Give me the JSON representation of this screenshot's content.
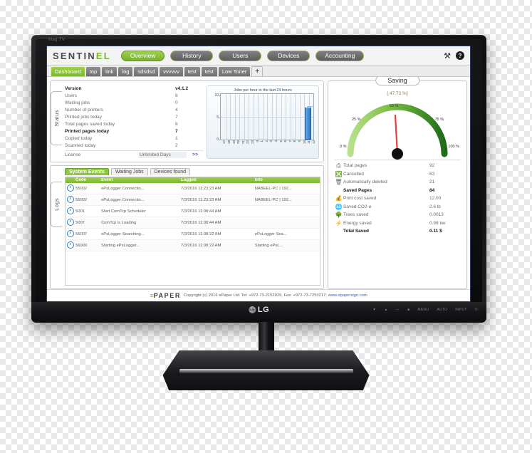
{
  "monitor": {
    "brand_top": "Mag TV",
    "lg_label": "LG",
    "lg_mark": "LG",
    "osd_buttons": [
      "▼",
      "▲",
      "—",
      "■",
      "MENU",
      "AUTO",
      "INPUT",
      "⏻"
    ]
  },
  "navbar": {
    "logo_prefix": "SENTIN",
    "logo_suffix": "EL",
    "buttons": [
      {
        "label": "Overview",
        "active": true
      },
      {
        "label": "History",
        "active": false
      },
      {
        "label": "Users",
        "active": false
      },
      {
        "label": "Devices",
        "active": false
      },
      {
        "label": "Accounting",
        "active": false
      }
    ],
    "tools_icon": "⚒",
    "help_icon": "?"
  },
  "tabs": [
    {
      "label": "Dashboard",
      "selected": true
    },
    {
      "label": "top",
      "selected": false
    },
    {
      "label": "link",
      "selected": false
    },
    {
      "label": "log",
      "selected": false
    },
    {
      "label": "sdsdsd",
      "selected": false
    },
    {
      "label": "vvvvvv",
      "selected": false
    },
    {
      "label": "test",
      "selected": false
    },
    {
      "label": "test",
      "selected": false
    },
    {
      "label": "Low Toner",
      "selected": false
    }
  ],
  "add_tab_label": "+",
  "side_tabs": {
    "status": "Status",
    "logs": "Logs"
  },
  "status": {
    "rows": [
      {
        "key": "Version",
        "value": "v4.1.2",
        "bold": true
      },
      {
        "key": "Users",
        "value": "6",
        "bold": false
      },
      {
        "key": "Waiting jobs",
        "value": "0",
        "bold": false
      },
      {
        "key": "Number of printers",
        "value": "4",
        "bold": false
      },
      {
        "key": "Printed jobs today",
        "value": "7",
        "bold": false
      },
      {
        "key": "Total pages saved today",
        "value": "6",
        "bold": false
      },
      {
        "key": "Printed pages today",
        "value": "7",
        "bold": true
      },
      {
        "key": "Copied today",
        "value": "1",
        "bold": false
      },
      {
        "key": "Scanned today",
        "value": "2",
        "bold": false
      }
    ],
    "license_key": "License",
    "license_value": "Unlimited Days",
    "more_link": ">>"
  },
  "chart_data": {
    "type": "bar",
    "title": "Jobs per hour in the last 24 hours",
    "xlabel": "",
    "ylabel": "",
    "ylim": [
      0,
      10
    ],
    "yticks": [
      0,
      5,
      10
    ],
    "grid": true,
    "legend": "none",
    "categories": [
      "17",
      "18",
      "19",
      "20",
      "21",
      "22",
      "23",
      "0",
      "1",
      "2",
      "3",
      "4",
      "5",
      "6",
      "7",
      "8",
      "9",
      "10",
      "11",
      "12"
    ],
    "values": [
      0,
      0,
      0,
      0,
      0,
      0,
      0,
      0,
      0,
      0,
      0,
      0,
      0,
      0,
      0,
      0,
      0,
      0,
      7,
      0
    ]
  },
  "logs": {
    "tabs": [
      {
        "label": "System Events",
        "selected": true
      },
      {
        "label": "Waiting Jobs",
        "selected": false
      },
      {
        "label": "Devices found",
        "selected": false
      }
    ],
    "columns": [
      "Code",
      "Event",
      "Logged",
      "Info"
    ],
    "rows": [
      {
        "icon": "clock-icon",
        "code": "55002",
        "event": "ePsLogger Connectio...",
        "logged": "7/3/2016 11:23:23 AM",
        "info": "NABEEL-PC | 192..."
      },
      {
        "icon": "clock-icon",
        "code": "55002",
        "event": "ePsLogger Connectio...",
        "logged": "7/3/2016 11:23:23 AM",
        "info": "NABEEL-PC | 192..."
      },
      {
        "icon": "clock-icon",
        "code": "5001",
        "event": "Start ComTcp Scheduler",
        "logged": "7/3/2016 11:08:44 AM",
        "info": ""
      },
      {
        "icon": "clock-icon",
        "code": "5007",
        "event": "ComTcp is Loading",
        "logged": "7/3/2016 11:08:44 AM",
        "info": ""
      },
      {
        "icon": "clock-icon",
        "code": "55007",
        "event": "ePsLogger Searching...",
        "logged": "7/3/2016 11:08:22 AM",
        "info": "ePsLogger Sea..."
      },
      {
        "icon": "clock-icon",
        "code": "56000",
        "event": "Starting ePsLogger...",
        "logged": "7/3/2016 11:08:22 AM",
        "info": "Starting ePsL..."
      }
    ]
  },
  "saving": {
    "title": "Saving",
    "percent_text": "[ 47.73 %]",
    "gauge_value": 47.73,
    "gauge_ticks": [
      "0 %",
      "25 %",
      "50 %",
      "75 %",
      "100 %"
    ],
    "rows": [
      {
        "icon": "printer-icon",
        "label": "Total pages",
        "value": "92",
        "bold": false
      },
      {
        "icon": "cancel-page-icon",
        "label": "Cancelled",
        "value": "63",
        "bold": false
      },
      {
        "icon": "trash-icon",
        "label": "Automatically deleted",
        "value": "21",
        "bold": false
      },
      {
        "icon": "",
        "label": "Saved Pages",
        "value": "84",
        "bold": true
      },
      {
        "icon": "money-bag-icon",
        "label": "Print cost saved",
        "value": "12.00",
        "bold": false
      },
      {
        "icon": "co2-icon",
        "label": "Saved CO2-e",
        "value": "2.6 lb",
        "bold": false
      },
      {
        "icon": "tree-icon",
        "label": "Trees saved",
        "value": "0.0013",
        "bold": false
      },
      {
        "icon": "energy-icon",
        "label": "Energy saved",
        "value": "0.98 kw",
        "bold": false
      },
      {
        "icon": "",
        "label": "Total Saved",
        "value": "0.11 $",
        "bold": true
      }
    ]
  },
  "footer": {
    "logo_bars": "≡",
    "logo_text": "PAPER",
    "copyright": "Copyright (c) 2016 ePaper Ltd. Tel: +972-73-2152929, Fax: +972-73-7253217,",
    "link": "www.epapersign.com"
  },
  "colors": {
    "accent_green": "#7cb82f",
    "bar_blue": "#2f76c4",
    "link_blue": "#2f5fd0",
    "needle_red": "#e8403a"
  }
}
